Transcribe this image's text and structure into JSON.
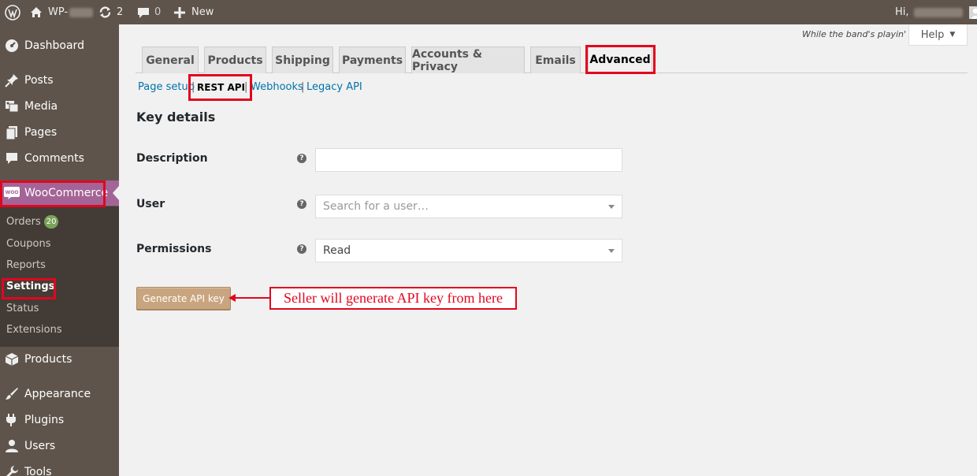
{
  "adminbar": {
    "site_name": "WP-",
    "updates_count": "2",
    "comments_count": "0",
    "new_label": "New",
    "greeting": "Hi,"
  },
  "sidebar": {
    "dashboard": "Dashboard",
    "posts": "Posts",
    "media": "Media",
    "pages": "Pages",
    "comments": "Comments",
    "woocommerce": "WooCommerce",
    "woo_icon_text": "WOO",
    "submenu": {
      "orders": "Orders",
      "orders_badge": "20",
      "coupons": "Coupons",
      "reports": "Reports",
      "settings": "Settings",
      "status": "Status",
      "extensions": "Extensions"
    },
    "products": "Products",
    "appearance": "Appearance",
    "plugins": "Plugins",
    "users": "Users",
    "tools": "Tools"
  },
  "header": {
    "tagline": "While the band's playin'",
    "help_label": "Help"
  },
  "tabs": [
    "General",
    "Products",
    "Shipping",
    "Payments",
    "Accounts & Privacy",
    "Emails",
    "Advanced"
  ],
  "subnav": {
    "page_setup": "Page setup",
    "rest_api": "REST API",
    "webhooks": "Webhooks",
    "legacy_api": "Legacy API",
    "separator": "|"
  },
  "form": {
    "title": "Key details",
    "description_label": "Description",
    "description_value": "",
    "user_label": "User",
    "user_placeholder": "Search for a user…",
    "permissions_label": "Permissions",
    "permissions_value": "Read",
    "help_glyph": "?",
    "generate_button": "Generate API key"
  },
  "annotation": {
    "text": "Seller will generate API key from here"
  },
  "colors": {
    "admin_dark": "#5e544c",
    "woo_purple": "#a46497",
    "highlight_red": "#e1061e",
    "link_blue": "#0073aa"
  }
}
